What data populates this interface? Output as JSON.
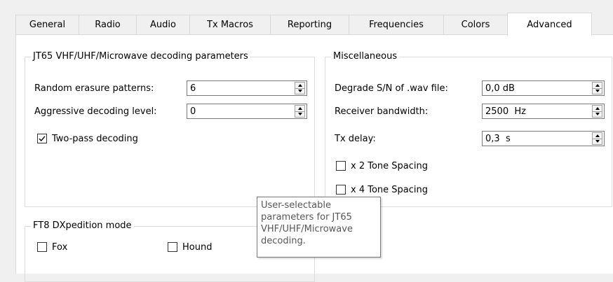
{
  "tabs": [
    {
      "label": "General",
      "active": false
    },
    {
      "label": "Radio",
      "active": false
    },
    {
      "label": "Audio",
      "active": false
    },
    {
      "label": "Tx Macros",
      "active": false
    },
    {
      "label": "Reporting",
      "active": false
    },
    {
      "label": "Frequencies",
      "active": false
    },
    {
      "label": "Colors",
      "active": false
    },
    {
      "label": "Advanced",
      "active": true
    }
  ],
  "jt65_group": {
    "title": "JT65 VHF/UHF/Microwave decoding parameters",
    "random_erasure": {
      "label": "Random erasure patterns:",
      "value": "6"
    },
    "aggressive": {
      "label": "Aggressive decoding level:",
      "value": "0"
    },
    "two_pass": {
      "label": "Two-pass decoding",
      "checked": true
    }
  },
  "misc_group": {
    "title": "Miscellaneous",
    "degrade": {
      "label": "Degrade S/N of .wav file:",
      "value": "0,0 dB"
    },
    "bandwidth": {
      "label": "Receiver bandwidth:",
      "value": "2500  Hz"
    },
    "tx_delay": {
      "label": "Tx delay:",
      "value": "0,3  s"
    },
    "x2_tone": {
      "label": "x 2 Tone Spacing",
      "checked": false
    },
    "x4_tone": {
      "label": "x 4 Tone Spacing",
      "checked": false
    }
  },
  "ft8_group": {
    "title": "FT8 DXpedition mode",
    "fox": {
      "label": "Fox",
      "checked": false
    },
    "hound": {
      "label": "Hound",
      "checked": false
    }
  },
  "tooltip": {
    "lines": [
      "User-selectable",
      "parameters for JT65",
      "VHF/UHF/Microwave",
      "decoding."
    ]
  }
}
